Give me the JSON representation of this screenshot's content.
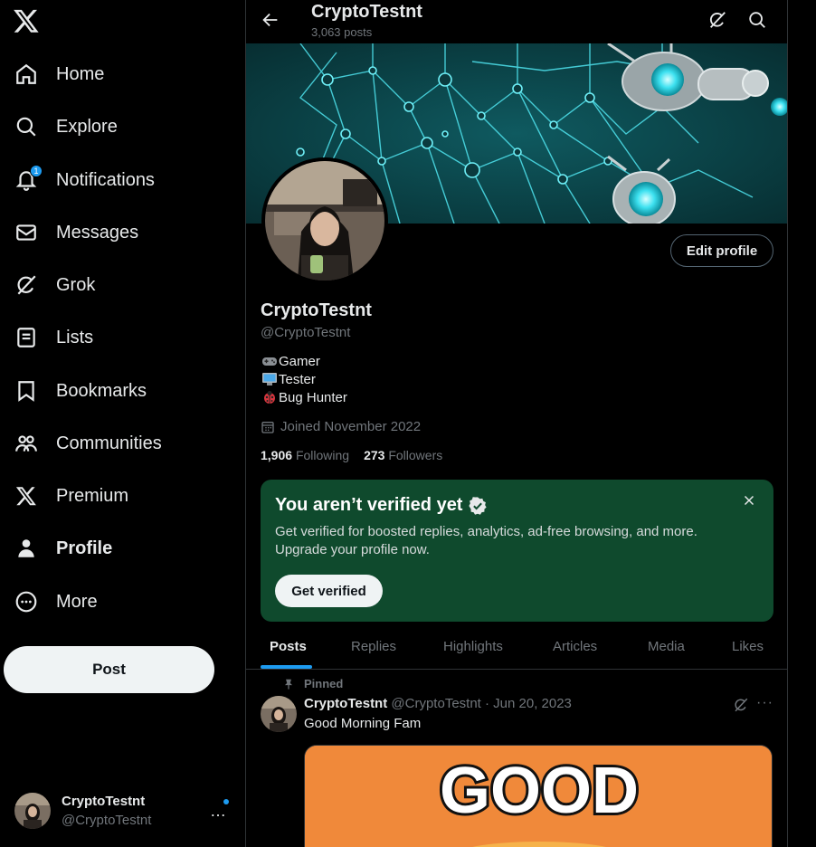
{
  "sidebar": {
    "logo": "x-logo",
    "items": [
      {
        "label": "Home",
        "icon": "home-icon"
      },
      {
        "label": "Explore",
        "icon": "search-icon"
      },
      {
        "label": "Notifications",
        "icon": "bell-icon",
        "badge": "1"
      },
      {
        "label": "Messages",
        "icon": "envelope-icon"
      },
      {
        "label": "Grok",
        "icon": "grok-icon"
      },
      {
        "label": "Lists",
        "icon": "list-icon"
      },
      {
        "label": "Bookmarks",
        "icon": "bookmark-icon"
      },
      {
        "label": "Communities",
        "icon": "people-icon"
      },
      {
        "label": "Premium",
        "icon": "x-icon"
      },
      {
        "label": "Profile",
        "icon": "person-icon"
      },
      {
        "label": "More",
        "icon": "more-circle-icon"
      }
    ],
    "post_label": "Post",
    "account": {
      "name": "CryptoTestnt",
      "handle": "@CryptoTestnt",
      "more": "…"
    }
  },
  "topbar": {
    "title": "CryptoTestnt",
    "subtitle": "3,063 posts"
  },
  "profile": {
    "edit_label": "Edit profile",
    "name": "CryptoTestnt",
    "handle": "@CryptoTestnt",
    "bio": [
      {
        "emoji": "gamepad-icon",
        "text": "Gamer"
      },
      {
        "emoji": "computer-icon",
        "text": "Tester"
      },
      {
        "emoji": "ladybug-icon",
        "text": "Bug Hunter"
      }
    ],
    "joined": "Joined November 2022",
    "following_count": "1,906",
    "following_label": "Following",
    "followers_count": "273",
    "followers_label": "Followers"
  },
  "verify": {
    "title": "You aren’t verified yet",
    "text": "Get verified for boosted replies, analytics, ad-free browsing, and more. Upgrade your profile now.",
    "button": "Get verified"
  },
  "tabs": [
    "Posts",
    "Replies",
    "Highlights",
    "Articles",
    "Media",
    "Likes"
  ],
  "tweet": {
    "pinned_label": "Pinned",
    "name": "CryptoTestnt",
    "handle_date": "@CryptoTestnt · Jun 20, 2023",
    "text": "Good Morning Fam",
    "media_text": "GOOD",
    "more": "···"
  },
  "colors": {
    "accent": "#1d9bf0",
    "verify_bg": "#0f4a2d",
    "muted": "#71767b"
  }
}
